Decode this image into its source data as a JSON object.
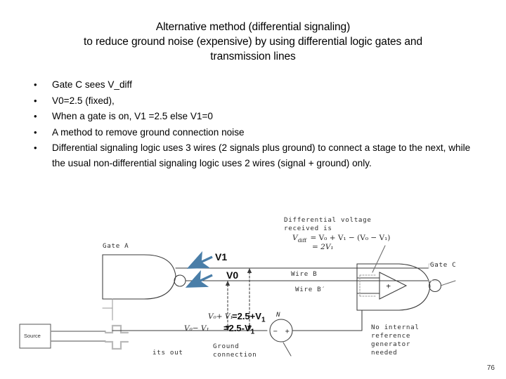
{
  "slide": {
    "page_number": "76",
    "accent_color": "#4a7ea8",
    "title_lines": [
      "Alternative method (differential signaling)",
      "to reduce ground noise (expensive) by using differential logic gates and",
      "transmission lines"
    ],
    "bullets": [
      "Gate C sees V_diff",
      "V0=2.5 (fixed),",
      "When a gate  is on, V1 =2.5 else V1=0",
      "A method to remove ground connection noise",
      "Differential signaling logic uses 3 wires (2 signals plus ground)  to connect a stage to the next, while the usual non-differential signaling logic uses 2 wires (signal + ground) only."
    ],
    "bullet_marker": "•"
  },
  "diagram": {
    "labels": {
      "gate_a": "Gate A",
      "gate_c": "Gate C",
      "wire_b": "Wire B",
      "wire_b_prime": "Wire B′",
      "ground_connection_line1": "Ground",
      "ground_connection_line2": "connection",
      "no_internal_line1": "No internal",
      "no_internal_line2": "reference",
      "no_internal_line3": "generator",
      "no_internal_line4": "needed",
      "its_out": "its out",
      "noise_source": "N",
      "noise_minus": "−",
      "noise_plus": "+",
      "source_box": "Source",
      "diff_voltage_line1": "Differential voltage",
      "diff_voltage_line2": "received is",
      "opamp_plus": "+"
    },
    "formulas": {
      "v_diff_lhs": "V",
      "v_diff_sub": "diff",
      "v_diff_rhs": "= V₀ + V₁ − (V₀ − V₁)",
      "v_diff_second": "= 2V₁",
      "v0_plus_v1": "V₀+ V₁",
      "v0_minus_v1": "V₀− V₁"
    },
    "annotations": {
      "v1": "V1",
      "v0": "V0",
      "eq_plus": "=2.5+V",
      "eq_plus_sub": "1",
      "eq_minus": "=2.5-V",
      "eq_minus_sub": "1"
    }
  }
}
